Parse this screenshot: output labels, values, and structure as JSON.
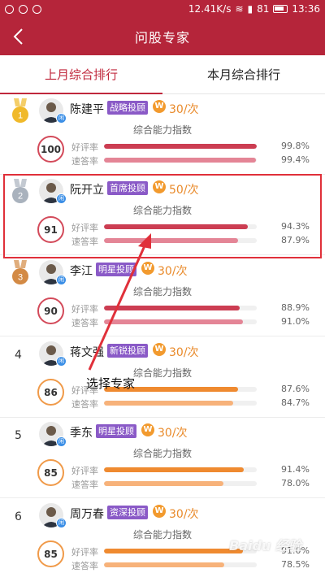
{
  "status_bar": {
    "speed": "12.41K/s",
    "battery": "81",
    "time": "13:36"
  },
  "navbar": {
    "title": "问股专家"
  },
  "tabs": [
    {
      "label": "上月综合排行",
      "active": true
    },
    {
      "label": "本月综合排行",
      "active": false
    }
  ],
  "labels": {
    "index_label": "综合能力指数",
    "good_rate": "好评率",
    "speed_rate": "速答率"
  },
  "experts": [
    {
      "rank": "1",
      "medal": "gold",
      "name": "陈建平",
      "tag": "战略投顾",
      "price": "30/次",
      "score": "100",
      "good": "99.8%",
      "good_v": 0.998,
      "fast": "99.4%",
      "fast_v": 0.994,
      "theme": "red"
    },
    {
      "rank": "2",
      "medal": "silver",
      "name": "阮开立",
      "tag": "首席投顾",
      "price": "50/次",
      "score": "91",
      "good": "94.3%",
      "good_v": 0.943,
      "fast": "87.9%",
      "fast_v": 0.879,
      "theme": "red"
    },
    {
      "rank": "3",
      "medal": "bronze",
      "name": "李江",
      "tag": "明星投顾",
      "price": "30/次",
      "score": "90",
      "good": "88.9%",
      "good_v": 0.889,
      "fast": "91.0%",
      "fast_v": 0.91,
      "theme": "red"
    },
    {
      "rank": "4",
      "medal": "",
      "name": "蒋文强",
      "tag": "新锐投顾",
      "price": "30/次",
      "score": "86",
      "good": "87.6%",
      "good_v": 0.876,
      "fast": "84.7%",
      "fast_v": 0.847,
      "theme": "orange"
    },
    {
      "rank": "5",
      "medal": "",
      "name": "季东",
      "tag": "明星投顾",
      "price": "30/次",
      "score": "85",
      "good": "91.4%",
      "good_v": 0.914,
      "fast": "78.0%",
      "fast_v": 0.78,
      "theme": "orange"
    },
    {
      "rank": "6",
      "medal": "",
      "name": "周万春",
      "tag": "资深投顾",
      "price": "30/次",
      "score": "85",
      "good": "91.0%",
      "good_v": 0.91,
      "fast": "78.5%",
      "fast_v": 0.785,
      "theme": "orange"
    }
  ],
  "annotation": {
    "text": "选择专家"
  },
  "watermark": "Baidu 经验",
  "colors": {
    "brand": "#b5253a",
    "accent": "#c0283c",
    "tag_purple": "#8a5ac7",
    "coin_orange": "#f29a2e",
    "highlight": "#e0303a"
  }
}
